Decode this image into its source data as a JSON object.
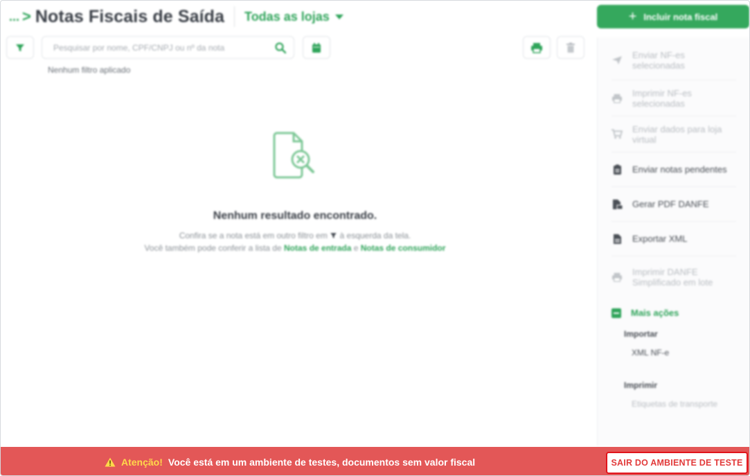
{
  "header": {
    "breadcrumb_ellipsis": "...",
    "breadcrumb_chevron": ">",
    "title": "Notas Fiscais de Saída",
    "store_selector": "Todas as lojas",
    "primary_button": "Incluir nota fiscal"
  },
  "toolbar": {
    "search_placeholder": "Pesquisar por nome, CPF/CNPJ ou nº da nota",
    "filter_status": "Nenhum filtro aplicado"
  },
  "empty_state": {
    "title": "Nenhum resultado encontrado.",
    "line1_before": "Confira se a nota está em outro filtro em",
    "line1_after": "à esquerda da tela.",
    "line2_before": "Você também pode conferir a lista de",
    "link_entrada": "Notas de entrada",
    "line2_and": "e",
    "link_consumidor": "Notas de consumidor"
  },
  "side_panel": {
    "items": [
      {
        "label": "Enviar NF-es selecionadas",
        "icon": "send-icon",
        "enabled": false
      },
      {
        "label": "Imprimir NF-es selecionadas",
        "icon": "printer-icon",
        "enabled": false
      },
      {
        "label": "Enviar dados para loja virtual",
        "icon": "cart-icon",
        "enabled": false
      },
      {
        "label": "Enviar notas pendentes",
        "icon": "clipboard-icon",
        "enabled": true
      },
      {
        "label": "Gerar PDF DANFE",
        "icon": "pdf-icon",
        "enabled": true
      },
      {
        "label": "Exportar XML",
        "icon": "file-icon",
        "enabled": true
      },
      {
        "label": "Imprimir DANFE Simplificado em lote",
        "icon": "printer-icon",
        "enabled": false
      }
    ],
    "more_actions": "Mais ações",
    "import_header": "Importar",
    "import_item": "XML NF-e",
    "print_header": "Imprimir",
    "print_item": "Etiquetas de transporte"
  },
  "test_banner": {
    "attention": "Atenção!",
    "message": "Você está em um ambiente de testes, documentos sem valor fiscal",
    "exit_button": "SAIR DO AMBIENTE DE TESTE"
  },
  "colors": {
    "brand_green": "#35a85d",
    "banner_red": "#e35757",
    "warning_yellow": "#ffd84a",
    "highlight_red": "#e1141b"
  }
}
